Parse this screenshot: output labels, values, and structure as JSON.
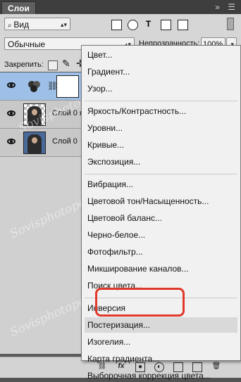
{
  "panel": {
    "tab_label": "Слои",
    "title_icons": "»  ☰"
  },
  "toolbar": {
    "filter_select": "Вид",
    "blend_mode": "Обычные",
    "opacity_label": "Непрозрачность:",
    "opacity_value": "100%",
    "lock_label": "Закрепить:"
  },
  "layers": [
    {
      "name": "",
      "type": "adjustment",
      "selected": true
    },
    {
      "name": "Слой 0 ко",
      "type": "image",
      "selected": false
    },
    {
      "name": "Слой 0",
      "type": "image",
      "selected": false
    }
  ],
  "menu": {
    "groups": [
      [
        "Цвет...",
        "Градиент...",
        "Узор..."
      ],
      [
        "Яркость/Контрастность...",
        "Уровни...",
        "Кривые...",
        "Экспозиция..."
      ],
      [
        "Вибрация...",
        "Цветовой тон/Насыщенность...",
        "Цветовой баланс...",
        "Черно-белое...",
        "Фотофильтр...",
        "Микширование каналов...",
        "Поиск цвета..."
      ],
      [
        "Инверсия",
        "Постеризация...",
        "Изогелия...",
        "Карта градиента...",
        "Выборочная коррекция цвета..."
      ]
    ],
    "highlighted": "Постеризация..."
  },
  "watermark": "Sovisphotopedia.ru",
  "colors": {
    "selection": "#9ec0e8",
    "highlight_box": "#e0392b"
  }
}
